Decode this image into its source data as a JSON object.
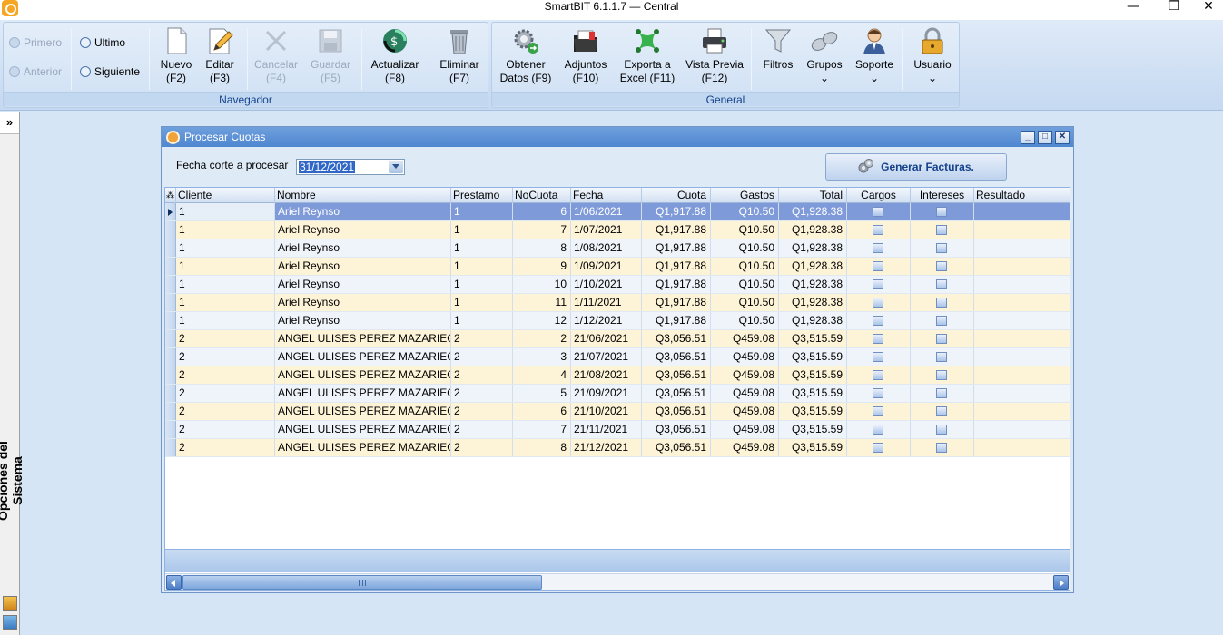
{
  "window": {
    "title": "SmartBIT 6.1.1.7 — Central",
    "controls": {
      "minimize": "—",
      "restore": "❐",
      "close": "✕"
    }
  },
  "ribbon": {
    "navegador": {
      "label": "Navegador",
      "primero": "Primero",
      "anterior": "Anterior",
      "ultimo": "Ultimo",
      "siguiente": "Siguiente",
      "nuevo": {
        "label": "Nuevo",
        "key": "(F2)"
      },
      "editar": {
        "label": "Editar",
        "key": "(F3)"
      },
      "cancelar": {
        "label": "Cancelar",
        "key": "(F4)"
      },
      "guardar": {
        "label": "Guardar",
        "key": "(F5)"
      },
      "actualizar": {
        "label": "Actualizar",
        "key": "(F8)"
      },
      "eliminar": {
        "label": "Eliminar",
        "key": "(F7)"
      }
    },
    "general": {
      "label": "General",
      "obtener": {
        "label": "Obtener",
        "key": "Datos (F9)"
      },
      "adjuntos": {
        "label": "Adjuntos",
        "key": "(F10)"
      },
      "exporta": {
        "label": "Exporta a",
        "key": "Excel (F11)"
      },
      "vista": {
        "label": "Vista Previa",
        "key": "(F12)"
      },
      "filtros": {
        "label": "Filtros"
      },
      "grupos": {
        "label": "Grupos",
        "key": "⌄"
      },
      "soporte": {
        "label": "Soporte",
        "key": "⌄"
      },
      "usuario": {
        "label": "Usuario",
        "key": "⌄"
      }
    }
  },
  "sidebar": {
    "expand": "»",
    "label": "Opciones del Sistema"
  },
  "form": {
    "title": "Procesar Cuotas",
    "controls": {
      "minimize": "_",
      "maximize": "□",
      "close": "✕"
    },
    "fecha_label": "Fecha corte a procesar",
    "fecha_value": "31/12/2021",
    "generate_button": "Generar Facturas."
  },
  "grid": {
    "header_marker": "⁂",
    "columns": {
      "cliente": "Cliente",
      "nombre": "Nombre",
      "prestamo": "Prestamo",
      "nocuota": "NoCuota",
      "fecha": "Fecha",
      "cuota": "Cuota",
      "gastos": "Gastos",
      "total": "Total",
      "cargos": "Cargos",
      "intereses": "Intereses",
      "resultado": "Resultado"
    },
    "rows": [
      {
        "cliente": "1",
        "nombre": "Ariel Reynso",
        "prestamo": "1",
        "nocuota": "6",
        "fecha": "1/06/2021",
        "cuota": "Q1,917.88",
        "gastos": "Q10.50",
        "total": "Q1,928.38",
        "resultado": ""
      },
      {
        "cliente": "1",
        "nombre": "Ariel Reynso",
        "prestamo": "1",
        "nocuota": "7",
        "fecha": "1/07/2021",
        "cuota": "Q1,917.88",
        "gastos": "Q10.50",
        "total": "Q1,928.38",
        "resultado": ""
      },
      {
        "cliente": "1",
        "nombre": "Ariel Reynso",
        "prestamo": "1",
        "nocuota": "8",
        "fecha": "1/08/2021",
        "cuota": "Q1,917.88",
        "gastos": "Q10.50",
        "total": "Q1,928.38",
        "resultado": ""
      },
      {
        "cliente": "1",
        "nombre": "Ariel Reynso",
        "prestamo": "1",
        "nocuota": "9",
        "fecha": "1/09/2021",
        "cuota": "Q1,917.88",
        "gastos": "Q10.50",
        "total": "Q1,928.38",
        "resultado": ""
      },
      {
        "cliente": "1",
        "nombre": "Ariel Reynso",
        "prestamo": "1",
        "nocuota": "10",
        "fecha": "1/10/2021",
        "cuota": "Q1,917.88",
        "gastos": "Q10.50",
        "total": "Q1,928.38",
        "resultado": ""
      },
      {
        "cliente": "1",
        "nombre": "Ariel Reynso",
        "prestamo": "1",
        "nocuota": "11",
        "fecha": "1/11/2021",
        "cuota": "Q1,917.88",
        "gastos": "Q10.50",
        "total": "Q1,928.38",
        "resultado": ""
      },
      {
        "cliente": "1",
        "nombre": "Ariel Reynso",
        "prestamo": "1",
        "nocuota": "12",
        "fecha": "1/12/2021",
        "cuota": "Q1,917.88",
        "gastos": "Q10.50",
        "total": "Q1,928.38",
        "resultado": ""
      },
      {
        "cliente": "2",
        "nombre": "ANGEL ULISES PEREZ MAZARIEGOS",
        "prestamo": "2",
        "nocuota": "2",
        "fecha": "21/06/2021",
        "cuota": "Q3,056.51",
        "gastos": "Q459.08",
        "total": "Q3,515.59",
        "resultado": ""
      },
      {
        "cliente": "2",
        "nombre": "ANGEL ULISES PEREZ MAZARIEGOS",
        "prestamo": "2",
        "nocuota": "3",
        "fecha": "21/07/2021",
        "cuota": "Q3,056.51",
        "gastos": "Q459.08",
        "total": "Q3,515.59",
        "resultado": ""
      },
      {
        "cliente": "2",
        "nombre": "ANGEL ULISES PEREZ MAZARIEGOS",
        "prestamo": "2",
        "nocuota": "4",
        "fecha": "21/08/2021",
        "cuota": "Q3,056.51",
        "gastos": "Q459.08",
        "total": "Q3,515.59",
        "resultado": ""
      },
      {
        "cliente": "2",
        "nombre": "ANGEL ULISES PEREZ MAZARIEGOS",
        "prestamo": "2",
        "nocuota": "5",
        "fecha": "21/09/2021",
        "cuota": "Q3,056.51",
        "gastos": "Q459.08",
        "total": "Q3,515.59",
        "resultado": ""
      },
      {
        "cliente": "2",
        "nombre": "ANGEL ULISES PEREZ MAZARIEGOS",
        "prestamo": "2",
        "nocuota": "6",
        "fecha": "21/10/2021",
        "cuota": "Q3,056.51",
        "gastos": "Q459.08",
        "total": "Q3,515.59",
        "resultado": ""
      },
      {
        "cliente": "2",
        "nombre": "ANGEL ULISES PEREZ MAZARIEGOS",
        "prestamo": "2",
        "nocuota": "7",
        "fecha": "21/11/2021",
        "cuota": "Q3,056.51",
        "gastos": "Q459.08",
        "total": "Q3,515.59",
        "resultado": ""
      },
      {
        "cliente": "2",
        "nombre": "ANGEL ULISES PEREZ MAZARIEGOS",
        "prestamo": "2",
        "nocuota": "8",
        "fecha": "21/12/2021",
        "cuota": "Q3,056.51",
        "gastos": "Q459.08",
        "total": "Q3,515.59",
        "resultado": ""
      }
    ],
    "selected_row": 0,
    "scroll_grip": "|||"
  },
  "colors": {
    "ribbon_bg": "#c5d9f1",
    "selected_row": "#7f9ad8",
    "row_even": "#eef4f9",
    "row_odd": "#fdf3d7",
    "accent": "#15428b"
  },
  "icons": {
    "app": "app-logo-icon",
    "primero": "first-record-icon",
    "anterior": "previous-record-icon",
    "ultimo": "last-record-icon",
    "siguiente": "next-record-icon",
    "nuevo": "new-document-icon",
    "editar": "edit-pencil-icon",
    "cancelar": "cancel-x-icon",
    "guardar": "save-disk-icon",
    "actualizar": "refresh-globe-icon",
    "eliminar": "trash-icon",
    "obtener": "gear-refresh-icon",
    "adjuntos": "folder-attach-icon",
    "exporta": "excel-export-icon",
    "vista": "printer-icon",
    "filtros": "funnel-icon",
    "grupos": "binoculars-icon",
    "soporte": "support-person-icon",
    "usuario": "padlock-icon",
    "generar": "gears-icon"
  }
}
